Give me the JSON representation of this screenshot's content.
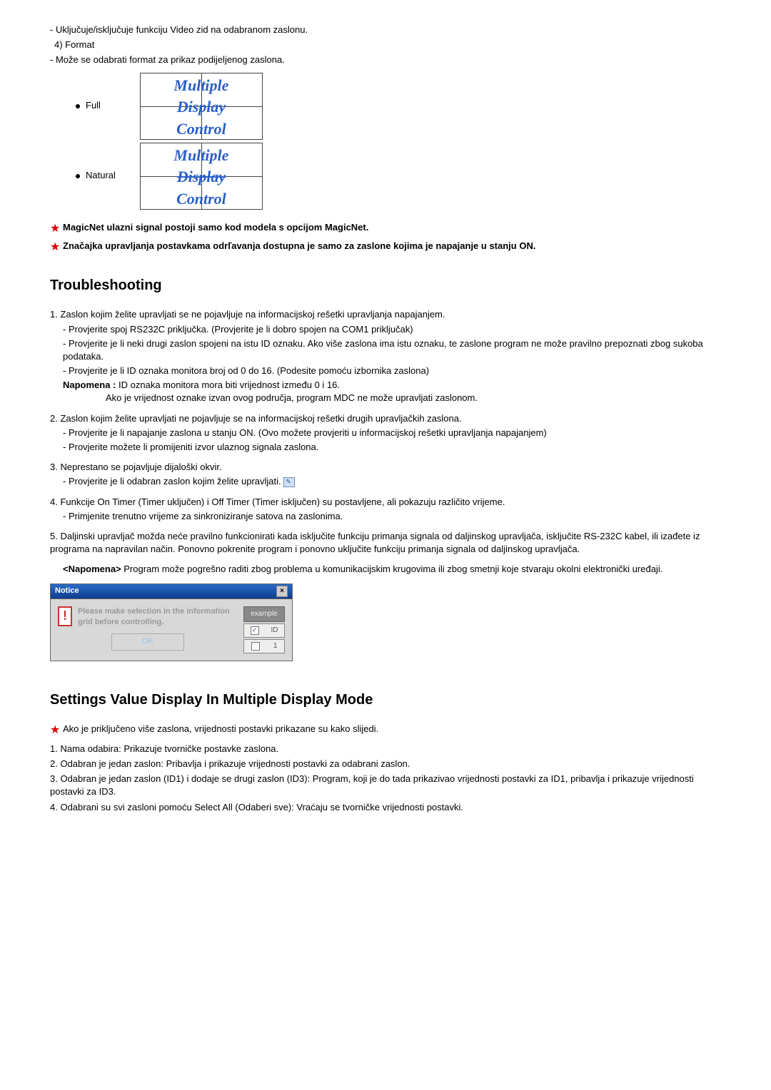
{
  "intro": {
    "video_wall_desc": "- Uključuje/isključuje funkciju Video zid na odabranom zaslonu.",
    "format_num": "4)  Format",
    "format_desc": "- Može se odabrati format za prikaz podijeljenog zaslona.",
    "full_label": "Full",
    "natural_label": "Natural",
    "mdc_line1": "Multiple",
    "mdc_line2": "Display",
    "mdc_line3": "Control"
  },
  "stars": {
    "s1": "MagicNet ulazni signal postoji samo kod modela s opcijom MagicNet.",
    "s2": "Značajka upravljanja postavkama odrľavanja dostupna je samo za zaslone kojima je napajanje u stanju ON."
  },
  "troubleshooting": {
    "title": "Troubleshooting",
    "item1": "1. Zaslon kojim želite upravljati se ne pojavljuje na informacijskoj rešetki upravljanja napajanjem.",
    "item1a": "- Provjerite spoj RS232C priključka. (Provjerite je li dobro spojen na COM1 priključak)",
    "item1b": "- Provjerite je li neki drugi zaslon spojeni na istu ID oznaku. Ako više zaslona ima istu oznaku, te zaslone program ne može pravilno prepoznati zbog sukoba podataka.",
    "item1c": "- Provjerite je li ID oznaka monitora broj od 0 do 16. (Podesite pomoću izbornika zaslona)",
    "item1_note_label": "Napomena : ",
    "item1_note_txt": "ID oznaka monitora mora biti vrijednost između 0 i 16.",
    "item1_note_txt2": "Ako je vrijednost oznake izvan ovog područja, program MDC ne može upravljati zaslonom.",
    "item2": "2. Zaslon kojim želite upravljati ne pojavljuje se na informacijskoj rešetki drugih upravljačkih zaslona.",
    "item2a": "- Provjerite je li napajanje zaslona u stanju ON. (Ovo možete provjeriti u informacijskoj rešetki upravljanja napajanjem)",
    "item2b": "- Provjerite možete li promijeniti izvor ulaznog signala zaslona.",
    "item3": "3. Neprestano se pojavljuje dijaloški okvir.",
    "item3a": "- Provjerite je li odabran zaslon kojim želite upravljati.",
    "item4": "4. Funkcije On Timer (Timer uključen) i Off Timer (Timer isključen) su postavljene, ali pokazuju različito vrijeme.",
    "item4a": "- Primjenite trenutno vrijeme za sinkroniziranje satova na zaslonima.",
    "item5": "5. Daljinski upravljač možda neće pravilno funkcionirati kada isključite funkciju primanja signala od daljinskog upravljača, isključite RS-232C kabel, ili izađete iz programa na napravilan način. Ponovno pokrenite program i ponovno uključite funkciju primanja signala od daljinskog upravljača.",
    "item5_note_label": "<Napomena> ",
    "item5_note_txt": "Program može pogrešno raditi zbog problema u komunikacijskim krugovima ili zbog smetnji koje stvaraju okolni elektronički uređaji."
  },
  "notice": {
    "title": "Notice",
    "msg": "Please make selection in the information grid before controlling.",
    "ok": "OK",
    "example": "example",
    "id": "ID",
    "one": "1"
  },
  "settings": {
    "title": "Settings Value Display In Multiple Display Mode",
    "star": "Ako je priključeno više zaslona, vrijednosti postavki prikazane su kako slijedi.",
    "l1": "1. Nama odabira: Prikazuje tvorničke postavke zaslona.",
    "l2": "2. Odabran je jedan zaslon: Pribavlja i prikazuje vrijednosti postavki za odabrani zaslon.",
    "l3": "3. Odabran je jedan zaslon (ID1) i dodaje se drugi zaslon (ID3): Program, koji je do tada prikazivao vrijednosti postavki za ID1, pribavlja i prikazuje vrijednosti postavki za ID3.",
    "l4": "4. Odabrani su svi zasloni pomoću Select All (Odaberi sve): Vraćaju se tvorničke vrijednosti postavki."
  }
}
